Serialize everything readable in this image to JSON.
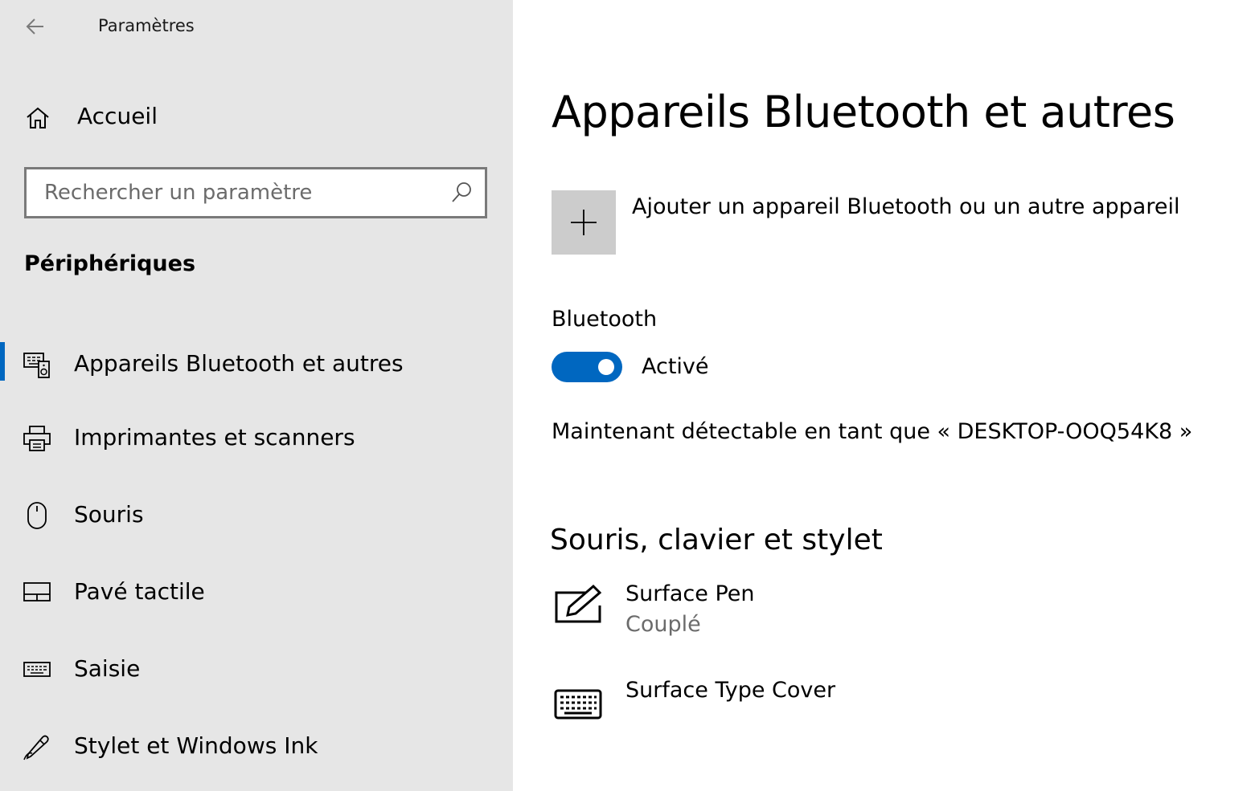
{
  "window": {
    "title": "Paramètres"
  },
  "sidebar": {
    "home_label": "Accueil",
    "search": {
      "placeholder": "Rechercher un paramètre",
      "value": ""
    },
    "section_title": "Périphériques",
    "items": [
      {
        "label": "Appareils Bluetooth et autres",
        "icon": "bluetooth-devices-icon",
        "active": true
      },
      {
        "label": "Imprimantes et scanners",
        "icon": "printer-icon",
        "active": false
      },
      {
        "label": "Souris",
        "icon": "mouse-icon",
        "active": false
      },
      {
        "label": "Pavé tactile",
        "icon": "touchpad-icon",
        "active": false
      },
      {
        "label": "Saisie",
        "icon": "keyboard-icon",
        "active": false
      },
      {
        "label": "Stylet et Windows Ink",
        "icon": "pen-icon",
        "active": false
      }
    ]
  },
  "main": {
    "title": "Appareils Bluetooth et autres",
    "add_device_label": "Ajouter un appareil Bluetooth ou un autre appareil",
    "bluetooth": {
      "label": "Bluetooth",
      "state_label": "Activé",
      "enabled": true
    },
    "discoverable_text": "Maintenant détectable en tant que « DESKTOP-OOQ54K8 »",
    "devices_section": {
      "title": "Souris, clavier et stylet",
      "devices": [
        {
          "name": "Surface Pen",
          "status": "Couplé",
          "icon": "pen-device-icon"
        },
        {
          "name": "Surface Type Cover",
          "status": "",
          "icon": "keyboard-device-icon"
        }
      ]
    }
  },
  "colors": {
    "accent": "#0067c0",
    "sidebar_bg": "#e6e6e6",
    "tile_bg": "#cccccc",
    "secondary_text": "#6b6b6b"
  }
}
